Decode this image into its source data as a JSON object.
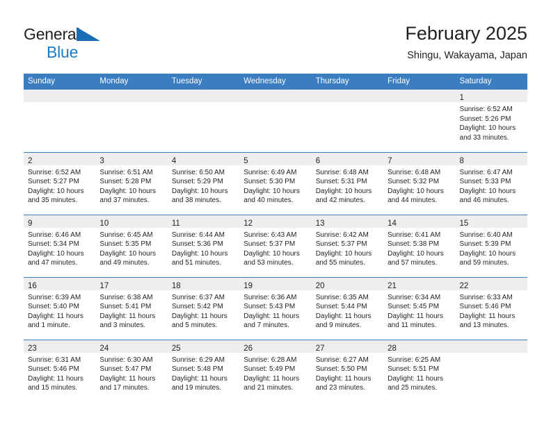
{
  "brand": {
    "line1": "General",
    "line2": "Blue",
    "triangle_color": "#1a6cb5",
    "blue_color": "#1a7cc4"
  },
  "header": {
    "title": "February 2025",
    "subtitle": "Shingu, Wakayama, Japan"
  },
  "theme": {
    "header_blue": "#3a7dc1",
    "daynum_band": "#eeeeee",
    "text": "#231f20"
  },
  "weekday_headers": [
    "Sunday",
    "Monday",
    "Tuesday",
    "Wednesday",
    "Thursday",
    "Friday",
    "Saturday"
  ],
  "labels": {
    "sunrise_prefix": "Sunrise:",
    "sunset_prefix": "Sunset:",
    "daylight_prefix": "Daylight:"
  },
  "weeks": [
    [
      {
        "day": "",
        "sunrise": "",
        "sunset": "",
        "daylight_1": "",
        "daylight_2": ""
      },
      {
        "day": "",
        "sunrise": "",
        "sunset": "",
        "daylight_1": "",
        "daylight_2": ""
      },
      {
        "day": "",
        "sunrise": "",
        "sunset": "",
        "daylight_1": "",
        "daylight_2": ""
      },
      {
        "day": "",
        "sunrise": "",
        "sunset": "",
        "daylight_1": "",
        "daylight_2": ""
      },
      {
        "day": "",
        "sunrise": "",
        "sunset": "",
        "daylight_1": "",
        "daylight_2": ""
      },
      {
        "day": "",
        "sunrise": "",
        "sunset": "",
        "daylight_1": "",
        "daylight_2": ""
      },
      {
        "day": "1",
        "sunrise": "Sunrise: 6:52 AM",
        "sunset": "Sunset: 5:26 PM",
        "daylight_1": "Daylight: 10 hours",
        "daylight_2": "and 33 minutes."
      }
    ],
    [
      {
        "day": "2",
        "sunrise": "Sunrise: 6:52 AM",
        "sunset": "Sunset: 5:27 PM",
        "daylight_1": "Daylight: 10 hours",
        "daylight_2": "and 35 minutes."
      },
      {
        "day": "3",
        "sunrise": "Sunrise: 6:51 AM",
        "sunset": "Sunset: 5:28 PM",
        "daylight_1": "Daylight: 10 hours",
        "daylight_2": "and 37 minutes."
      },
      {
        "day": "4",
        "sunrise": "Sunrise: 6:50 AM",
        "sunset": "Sunset: 5:29 PM",
        "daylight_1": "Daylight: 10 hours",
        "daylight_2": "and 38 minutes."
      },
      {
        "day": "5",
        "sunrise": "Sunrise: 6:49 AM",
        "sunset": "Sunset: 5:30 PM",
        "daylight_1": "Daylight: 10 hours",
        "daylight_2": "and 40 minutes."
      },
      {
        "day": "6",
        "sunrise": "Sunrise: 6:48 AM",
        "sunset": "Sunset: 5:31 PM",
        "daylight_1": "Daylight: 10 hours",
        "daylight_2": "and 42 minutes."
      },
      {
        "day": "7",
        "sunrise": "Sunrise: 6:48 AM",
        "sunset": "Sunset: 5:32 PM",
        "daylight_1": "Daylight: 10 hours",
        "daylight_2": "and 44 minutes."
      },
      {
        "day": "8",
        "sunrise": "Sunrise: 6:47 AM",
        "sunset": "Sunset: 5:33 PM",
        "daylight_1": "Daylight: 10 hours",
        "daylight_2": "and 46 minutes."
      }
    ],
    [
      {
        "day": "9",
        "sunrise": "Sunrise: 6:46 AM",
        "sunset": "Sunset: 5:34 PM",
        "daylight_1": "Daylight: 10 hours",
        "daylight_2": "and 47 minutes."
      },
      {
        "day": "10",
        "sunrise": "Sunrise: 6:45 AM",
        "sunset": "Sunset: 5:35 PM",
        "daylight_1": "Daylight: 10 hours",
        "daylight_2": "and 49 minutes."
      },
      {
        "day": "11",
        "sunrise": "Sunrise: 6:44 AM",
        "sunset": "Sunset: 5:36 PM",
        "daylight_1": "Daylight: 10 hours",
        "daylight_2": "and 51 minutes."
      },
      {
        "day": "12",
        "sunrise": "Sunrise: 6:43 AM",
        "sunset": "Sunset: 5:37 PM",
        "daylight_1": "Daylight: 10 hours",
        "daylight_2": "and 53 minutes."
      },
      {
        "day": "13",
        "sunrise": "Sunrise: 6:42 AM",
        "sunset": "Sunset: 5:37 PM",
        "daylight_1": "Daylight: 10 hours",
        "daylight_2": "and 55 minutes."
      },
      {
        "day": "14",
        "sunrise": "Sunrise: 6:41 AM",
        "sunset": "Sunset: 5:38 PM",
        "daylight_1": "Daylight: 10 hours",
        "daylight_2": "and 57 minutes."
      },
      {
        "day": "15",
        "sunrise": "Sunrise: 6:40 AM",
        "sunset": "Sunset: 5:39 PM",
        "daylight_1": "Daylight: 10 hours",
        "daylight_2": "and 59 minutes."
      }
    ],
    [
      {
        "day": "16",
        "sunrise": "Sunrise: 6:39 AM",
        "sunset": "Sunset: 5:40 PM",
        "daylight_1": "Daylight: 11 hours",
        "daylight_2": "and 1 minute."
      },
      {
        "day": "17",
        "sunrise": "Sunrise: 6:38 AM",
        "sunset": "Sunset: 5:41 PM",
        "daylight_1": "Daylight: 11 hours",
        "daylight_2": "and 3 minutes."
      },
      {
        "day": "18",
        "sunrise": "Sunrise: 6:37 AM",
        "sunset": "Sunset: 5:42 PM",
        "daylight_1": "Daylight: 11 hours",
        "daylight_2": "and 5 minutes."
      },
      {
        "day": "19",
        "sunrise": "Sunrise: 6:36 AM",
        "sunset": "Sunset: 5:43 PM",
        "daylight_1": "Daylight: 11 hours",
        "daylight_2": "and 7 minutes."
      },
      {
        "day": "20",
        "sunrise": "Sunrise: 6:35 AM",
        "sunset": "Sunset: 5:44 PM",
        "daylight_1": "Daylight: 11 hours",
        "daylight_2": "and 9 minutes."
      },
      {
        "day": "21",
        "sunrise": "Sunrise: 6:34 AM",
        "sunset": "Sunset: 5:45 PM",
        "daylight_1": "Daylight: 11 hours",
        "daylight_2": "and 11 minutes."
      },
      {
        "day": "22",
        "sunrise": "Sunrise: 6:33 AM",
        "sunset": "Sunset: 5:46 PM",
        "daylight_1": "Daylight: 11 hours",
        "daylight_2": "and 13 minutes."
      }
    ],
    [
      {
        "day": "23",
        "sunrise": "Sunrise: 6:31 AM",
        "sunset": "Sunset: 5:46 PM",
        "daylight_1": "Daylight: 11 hours",
        "daylight_2": "and 15 minutes."
      },
      {
        "day": "24",
        "sunrise": "Sunrise: 6:30 AM",
        "sunset": "Sunset: 5:47 PM",
        "daylight_1": "Daylight: 11 hours",
        "daylight_2": "and 17 minutes."
      },
      {
        "day": "25",
        "sunrise": "Sunrise: 6:29 AM",
        "sunset": "Sunset: 5:48 PM",
        "daylight_1": "Daylight: 11 hours",
        "daylight_2": "and 19 minutes."
      },
      {
        "day": "26",
        "sunrise": "Sunrise: 6:28 AM",
        "sunset": "Sunset: 5:49 PM",
        "daylight_1": "Daylight: 11 hours",
        "daylight_2": "and 21 minutes."
      },
      {
        "day": "27",
        "sunrise": "Sunrise: 6:27 AM",
        "sunset": "Sunset: 5:50 PM",
        "daylight_1": "Daylight: 11 hours",
        "daylight_2": "and 23 minutes."
      },
      {
        "day": "28",
        "sunrise": "Sunrise: 6:25 AM",
        "sunset": "Sunset: 5:51 PM",
        "daylight_1": "Daylight: 11 hours",
        "daylight_2": "and 25 minutes."
      },
      {
        "day": "",
        "sunrise": "",
        "sunset": "",
        "daylight_1": "",
        "daylight_2": ""
      }
    ]
  ]
}
